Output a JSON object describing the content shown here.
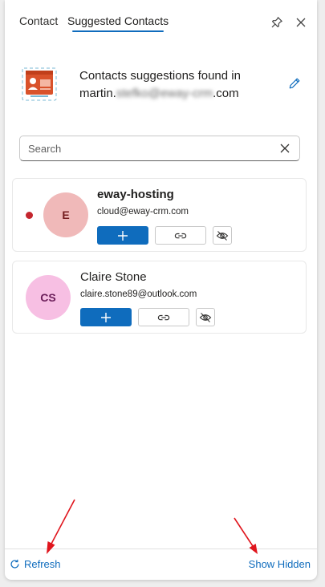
{
  "tabs": [
    {
      "label": "Contact",
      "active": false
    },
    {
      "label": "Suggested Contacts",
      "active": true
    }
  ],
  "header": {
    "line1": "Contacts suggestions found in",
    "email_prefix": "martin.",
    "email_blurred": "stefko@eway-crm",
    "email_suffix": ".com"
  },
  "search": {
    "placeholder": "Search"
  },
  "contacts": [
    {
      "initials": "E",
      "name": "eway-hosting",
      "email": "cloud@eway-crm.com",
      "unread": true,
      "avatar_bg": "#f0b9b9",
      "avatar_fg": "#751d1f"
    },
    {
      "initials": "CS",
      "name": "Claire Stone",
      "email": "claire.stone89@outlook.com",
      "unread": false,
      "avatar_bg": "#f7bfe3",
      "avatar_fg": "#6b1d59"
    }
  ],
  "footer": {
    "refresh_label": "Refresh",
    "show_hidden_label": "Show Hidden"
  },
  "colors": {
    "accent": "#0f6cbd",
    "annotation_arrow": "#e0151d",
    "unread_dot": "#c4262e"
  }
}
